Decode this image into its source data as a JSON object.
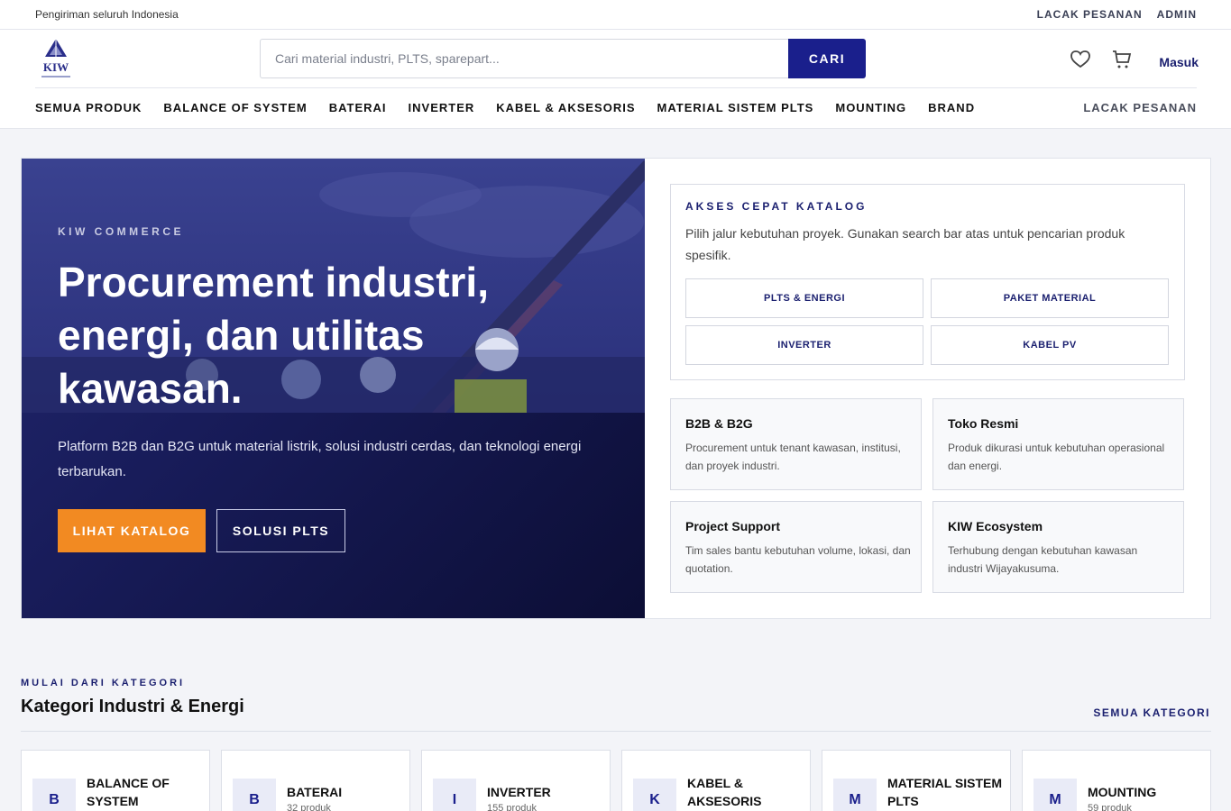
{
  "topbar": {
    "shipping": "Pengiriman seluruh Indonesia",
    "track_order": "LACAK PESANAN",
    "admin": "ADMIN"
  },
  "header": {
    "search_placeholder": "Cari material industri, PLTS, sparepart...",
    "search_button": "CARI",
    "login": "Masuk"
  },
  "nav": {
    "items": [
      "SEMUA PRODUK",
      "BALANCE OF SYSTEM",
      "BATERAI",
      "INVERTER",
      "KABEL & AKSESORIS",
      "MATERIAL SISTEM PLTS",
      "MOUNTING",
      "BRAND"
    ],
    "right": "LACAK PESANAN"
  },
  "hero": {
    "kicker": "KIW COMMERCE",
    "title": "Procurement industri, energi, dan utilitas kawasan.",
    "description": "Platform B2B dan B2G untuk material listrik, solusi industri cerdas, dan teknologi energi terbarukan.",
    "primary_button": "LIHAT KATALOG",
    "secondary_button": "SOLUSI PLTS"
  },
  "quick_access": {
    "title": "AKSES CEPAT KATALOG",
    "description": "Pilih jalur kebutuhan proyek. Gunakan search bar atas untuk pencarian produk spesifik.",
    "buttons": [
      "PLTS & ENERGI",
      "PAKET MATERIAL",
      "INVERTER",
      "KABEL PV"
    ]
  },
  "features": [
    {
      "title": "B2B & B2G",
      "description": "Procurement untuk tenant kawasan, institusi, dan proyek industri."
    },
    {
      "title": "Toko Resmi",
      "description": "Produk dikurasi untuk kebutuhan operasional dan energi."
    },
    {
      "title": "Project Support",
      "description": "Tim sales bantu kebutuhan volume, lokasi, dan quotation."
    },
    {
      "title": "KIW Ecosystem",
      "description": "Terhubung dengan kebutuhan kawasan industri Wijayakusuma."
    }
  ],
  "categories": {
    "kicker": "MULAI DARI KATEGORI",
    "title": "Kategori Industri & Energi",
    "all_link": "SEMUA KATEGORI",
    "items": [
      {
        "badge": "B",
        "name": "BALANCE OF SYSTEM",
        "count": ""
      },
      {
        "badge": "B",
        "name": "BATERAI",
        "count": "32 produk"
      },
      {
        "badge": "I",
        "name": "INVERTER",
        "count": "155 produk"
      },
      {
        "badge": "K",
        "name": "KABEL & AKSESORIS",
        "count": ""
      },
      {
        "badge": "M",
        "name": "MATERIAL SISTEM PLTS",
        "count": ""
      },
      {
        "badge": "M",
        "name": "MOUNTING",
        "count": "59 produk"
      }
    ]
  },
  "colors": {
    "brand": "#1a1f8c",
    "accent": "#f28a22",
    "hero_bg": "#181c5a"
  },
  "icons": {
    "wishlist": "heart-icon",
    "cart": "cart-icon",
    "logo": "kiw-logo"
  }
}
